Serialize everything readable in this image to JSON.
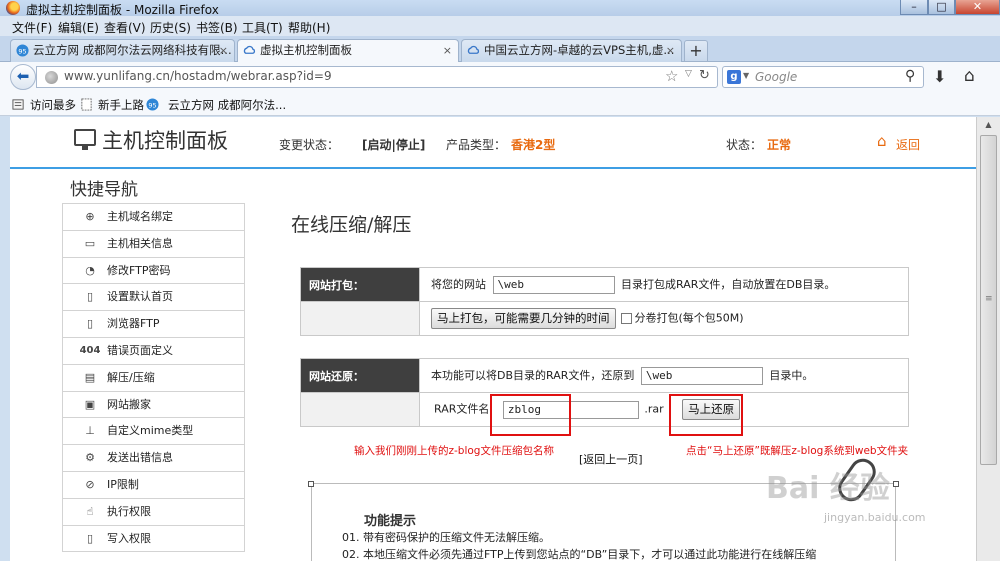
{
  "window": {
    "title": "虚拟主机控制面板 - Mozilla Firefox",
    "min_icon": "minimize-icon",
    "max_icon": "maximize-icon",
    "close_icon": "close-icon"
  },
  "menu": [
    "文件(F)",
    "编辑(E)",
    "查看(V)",
    "历史(S)",
    "书签(B)",
    "工具(T)",
    "帮助(H)"
  ],
  "tabs": [
    {
      "label": "云立方网 成都阿尔法云网络科技有限...",
      "close": "×",
      "active": false
    },
    {
      "label": "虚拟主机控制面板",
      "close": "×",
      "active": true
    },
    {
      "label": "中国云立方网-卓越的云VPS主机,虚...",
      "close": "×",
      "active": false
    }
  ],
  "new_tab": "+",
  "nav": {
    "url": "www.yunlifang.cn/hostadm/webrar.asp?id=9",
    "search_placeholder": "Google",
    "search_engine": "g"
  },
  "bookmarks": [
    "访问最多",
    "新手上路",
    "云立方网 成都阿尔法..."
  ],
  "header": {
    "title": "主机控制面板",
    "change_status_label": "变更状态：",
    "change_status_value": "[启动|停止]",
    "product_label": "产品类型：",
    "product_value": "香港2型",
    "status_label": "状态：",
    "status_value": "正常",
    "return_label": "返回",
    "accent_color": "#3d9ee4",
    "orange_color": "#e86a10"
  },
  "sidebar": {
    "title": "快捷导航",
    "items": [
      {
        "label": "主机域名绑定",
        "icon": "globe-link-icon"
      },
      {
        "label": "主机相关信息",
        "icon": "monitor-icon"
      },
      {
        "label": "修改FTP密码",
        "icon": "gauge-icon"
      },
      {
        "label": "设置默认首页",
        "icon": "document-icon"
      },
      {
        "label": "浏览器FTP",
        "icon": "document-icon"
      },
      {
        "label": "错误页面定义",
        "icon": "error-404-icon",
        "prefix": "404"
      },
      {
        "label": "解压/压缩",
        "icon": "archive-icon"
      },
      {
        "label": "网站搬家",
        "icon": "truck-icon"
      },
      {
        "label": "自定义mime类型",
        "icon": "network-icon"
      },
      {
        "label": "发送出错信息",
        "icon": "mail-gear-icon"
      },
      {
        "label": "IP限制",
        "icon": "block-icon"
      },
      {
        "label": "执行权限",
        "icon": "cursor-icon"
      },
      {
        "label": "写入权限",
        "icon": "document-icon"
      }
    ]
  },
  "main": {
    "title": "在线压缩/解压",
    "pack": {
      "label": "网站打包：",
      "text_before": "将您的网站",
      "path_value": "\\web",
      "text_after": "目录打包成RAR文件，自动放置在DB目录。",
      "button": "马上打包，可能需要几分钟的时间",
      "split_label": "分卷打包(每个包50M)"
    },
    "restore": {
      "label": "网站还原：",
      "text_before": "本功能可以将DB目录的RAR文件，还原到",
      "path_value": "\\web",
      "text_after": "目录中。",
      "file_label": "RAR文件名",
      "file_value": "zblog",
      "ext": ".rar",
      "button": "马上还原"
    },
    "annotation_left": "输入我们刚刚上传的z-blog文件压缩包名称",
    "annotation_right": "点击“马上还原”既解压z-blog系统到web文件夹",
    "back_link": "[返回上一页]",
    "tips": {
      "title": "功能提示",
      "lines": [
        "01. 带有密码保护的压缩文件无法解压缩。",
        "02. 本地压缩文件必须先通过FTP上传到您站点的“DB”目录下，才可以通过此功能进行在线解压缩"
      ]
    }
  },
  "watermark": {
    "text": "Bai 经验",
    "sub": "jingyan.baidu.com"
  }
}
